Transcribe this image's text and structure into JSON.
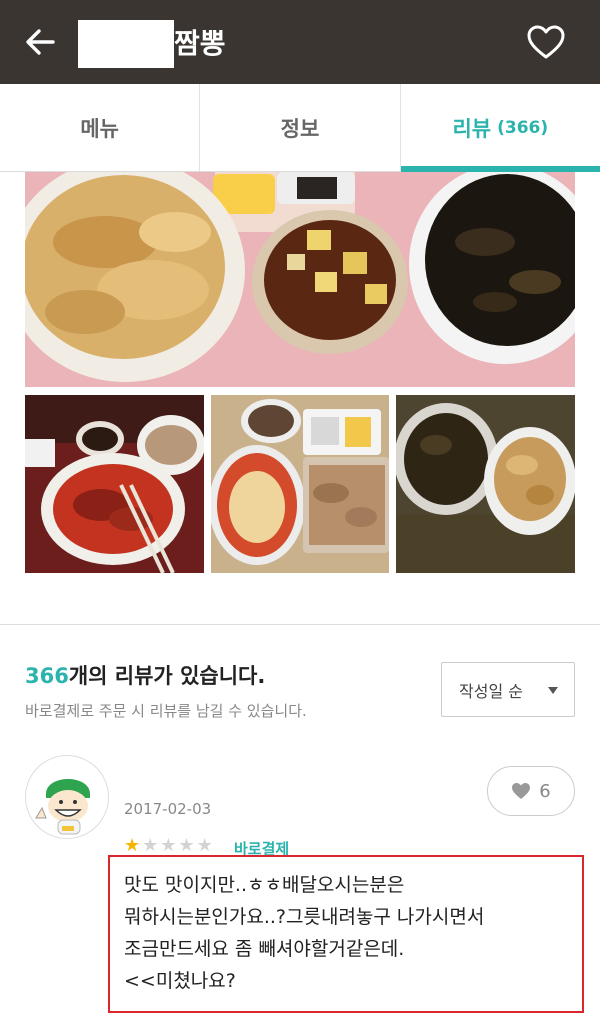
{
  "header": {
    "title": "짬뽕",
    "back_icon": "arrow-left-icon",
    "favorite_icon": "heart-outline-icon"
  },
  "tabs": [
    {
      "label": "메뉴",
      "active": false
    },
    {
      "label": "정보",
      "active": false
    },
    {
      "label": "리뷰",
      "count": "(366)",
      "active": true
    }
  ],
  "colors": {
    "accent": "#2bb3ad",
    "header_bg": "#3a3530",
    "highlight_border": "#d8282c",
    "star": "#f6b500"
  },
  "review_summary": {
    "count": "366",
    "count_suffix": "개의 리뷰가 있습니다.",
    "note": "바로결제로 주문 시 리뷰를 남길 수 있습니다.",
    "sort_label": "작성일 순"
  },
  "review": {
    "avatar_icon": "helmet-character-avatar",
    "date": "2017-02-03",
    "likes": "6",
    "rating": 1,
    "rating_max": 5,
    "tag": "바로결제",
    "text": "맛도 맛이지만..ㅎㅎ배달오시는분은\n뭐하시는분인가요..?그릇내려놓구 나가시면서\n조금만드세요 좀 빼셔야할거같은데.\n<<미쳤나요?"
  }
}
